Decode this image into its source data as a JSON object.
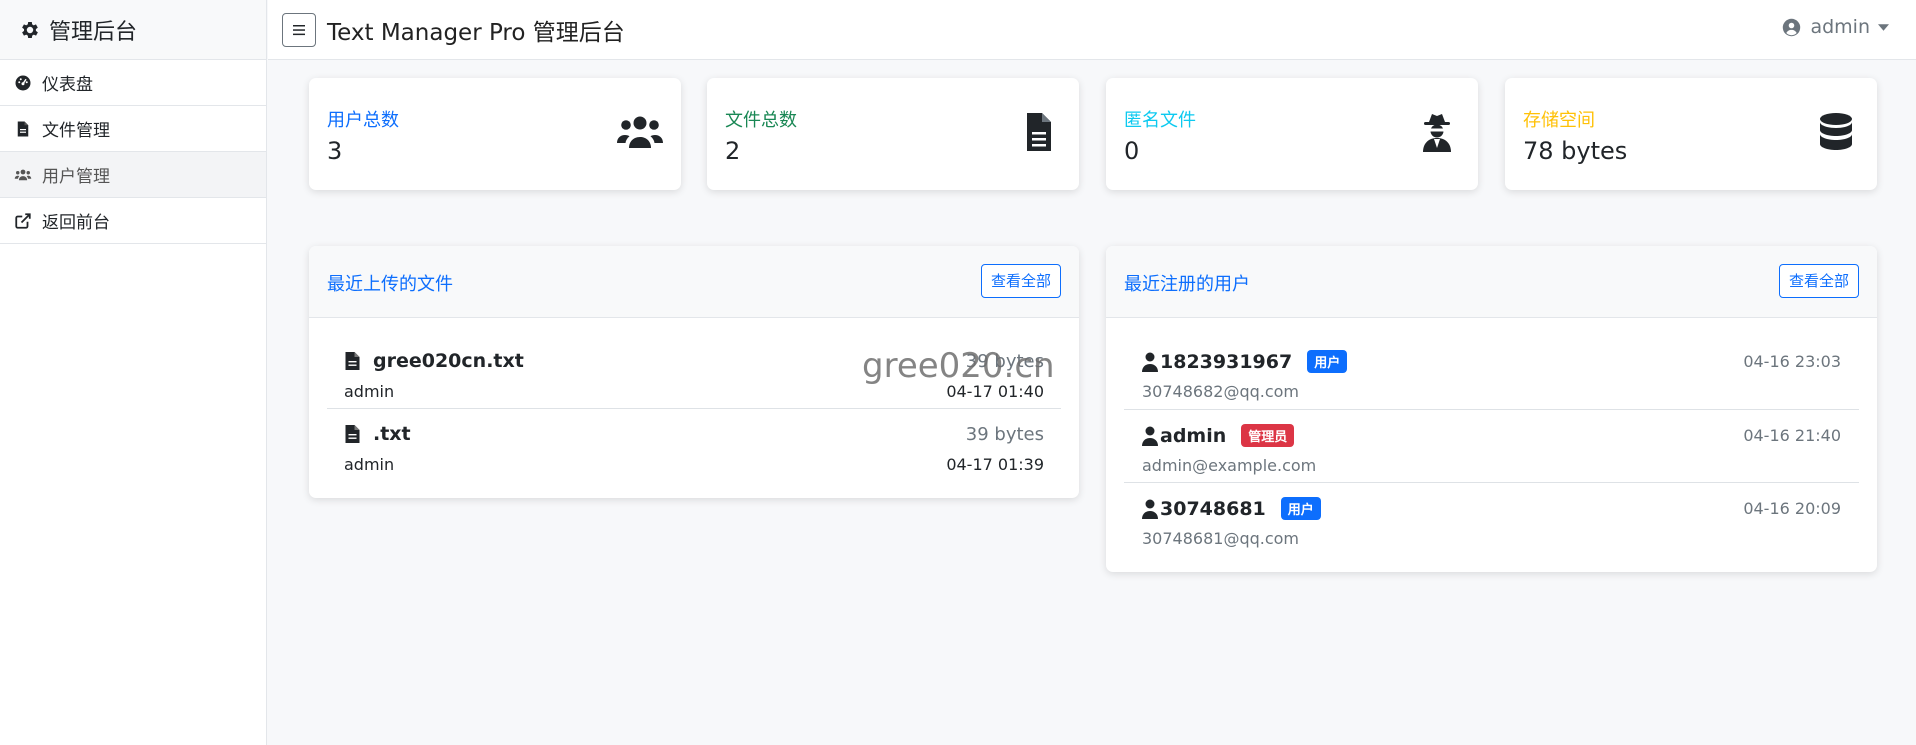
{
  "sidebar": {
    "brand": "管理后台",
    "items": [
      {
        "label": "仪表盘",
        "icon": "dashboard-icon"
      },
      {
        "label": "文件管理",
        "icon": "file-icon"
      },
      {
        "label": "用户管理",
        "icon": "users-icon"
      },
      {
        "label": "返回前台",
        "icon": "external-link-icon"
      }
    ]
  },
  "header": {
    "title": "Text Manager Pro 管理后台",
    "user": "admin"
  },
  "stats": [
    {
      "label": "用户总数",
      "value": "3",
      "color": "#0d6efd",
      "icon": "users-icon"
    },
    {
      "label": "文件总数",
      "value": "2",
      "color": "#198754",
      "icon": "file-icon"
    },
    {
      "label": "匿名文件",
      "value": "0",
      "color": "#0dcaf0",
      "icon": "user-secret-icon"
    },
    {
      "label": "存储空间",
      "value": "78 bytes",
      "color": "#ffc107",
      "icon": "database-icon"
    }
  ],
  "recent_files": {
    "title": "最近上传的文件",
    "view_all": "查看全部",
    "rows": [
      {
        "name": "gree020cn.txt",
        "owner": "admin",
        "size": "39 bytes",
        "date": "04-17 01:40"
      },
      {
        "name": ".txt",
        "owner": "admin",
        "size": "39 bytes",
        "date": "04-17 01:39"
      }
    ]
  },
  "recent_users": {
    "title": "最近注册的用户",
    "view_all": "查看全部",
    "rows": [
      {
        "name": "1823931967",
        "role": "用户",
        "role_color": "#0d6efd",
        "email": "30748682@qq.com",
        "date": "04-16 23:03"
      },
      {
        "name": "admin",
        "role": "管理员",
        "role_color": "#dc3545",
        "email": "admin@example.com",
        "date": "04-16 21:40"
      },
      {
        "name": "30748681",
        "role": "用户",
        "role_color": "#0d6efd",
        "email": "30748681@qq.com",
        "date": "04-16 20:09"
      }
    ]
  },
  "watermark": "gree020.cn"
}
